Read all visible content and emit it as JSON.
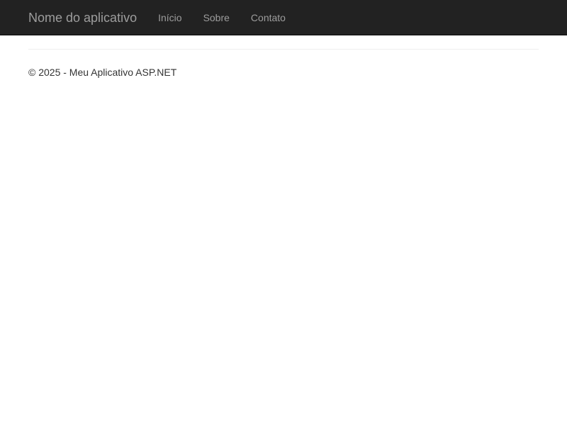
{
  "navbar": {
    "brand": "Nome do aplicativo",
    "items": [
      {
        "label": "Início"
      },
      {
        "label": "Sobre"
      },
      {
        "label": "Contato"
      }
    ]
  },
  "footer": {
    "text": "© 2025 - Meu Aplicativo ASP.NET"
  },
  "colors": {
    "navbar_bg": "#222222",
    "nav_text": "#9d9d9d",
    "body_text": "#333333"
  }
}
